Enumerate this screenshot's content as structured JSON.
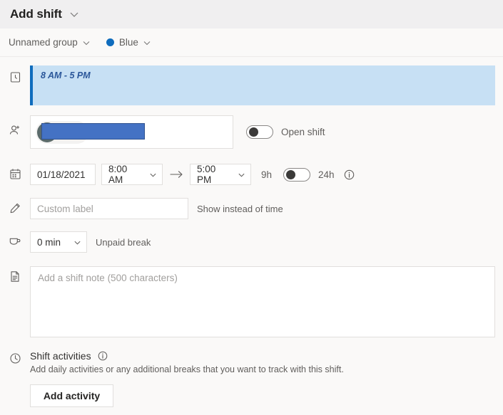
{
  "header": {
    "title": "Add shift",
    "chevron_icon": "chevron-down-icon"
  },
  "subheader": {
    "group_label": "Unnamed group",
    "color_label": "Blue",
    "color_hex": "#0f6cbd",
    "chevron_icon": "chevron-down-icon"
  },
  "time_banner": {
    "icon": "clock-square-icon",
    "text": "8 AM - 5 PM",
    "background_hex": "#c7e0f4",
    "accent_hex": "#0f6cbd"
  },
  "member": {
    "icon": "person-add-icon",
    "chip_name": "",
    "remove_label": "×",
    "open_shift": {
      "label": "Open shift",
      "on": false
    }
  },
  "schedule": {
    "icon": "calendar-icon",
    "date": "01/18/2021",
    "start_time": "8:00 AM",
    "end_time": "5:00 PM",
    "arrow": "→",
    "duration": "9h",
    "twentyfour_hour": {
      "label": "24h",
      "on": false
    },
    "info_icon": "info-icon"
  },
  "custom_label": {
    "icon": "pencil-icon",
    "placeholder": "Custom label",
    "value": "",
    "hint": "Show instead of time"
  },
  "break": {
    "icon": "coffee-cup-icon",
    "value": "0 min",
    "label": "Unpaid break"
  },
  "note": {
    "icon": "note-icon",
    "placeholder": "Add a shift note (500 characters)",
    "value": ""
  },
  "activities": {
    "icon": "clock-circle-icon",
    "title": "Shift activities",
    "info_icon": "info-icon",
    "description": "Add daily activities or any additional breaks that you want to track with this shift.",
    "add_button_label": "Add activity"
  }
}
